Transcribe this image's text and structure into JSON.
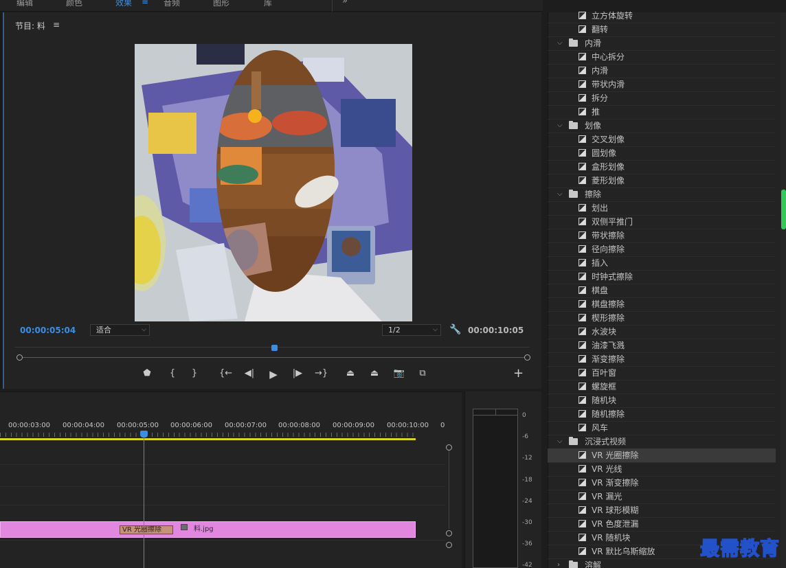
{
  "workspace_tabs": [
    {
      "label": "编辑",
      "active": false
    },
    {
      "label": "颜色",
      "active": false
    },
    {
      "label": "效果",
      "active": true
    },
    {
      "label": "音频",
      "active": false
    },
    {
      "label": "图形",
      "active": false
    },
    {
      "label": "库",
      "active": false
    }
  ],
  "workspace_more": "»",
  "program_monitor": {
    "title": "节目: 料",
    "menu_icon": "≡",
    "current_time": "00:00:05:04",
    "fit_select": "适合",
    "resolution_select": "1/2",
    "duration": "00:00:10:05",
    "scrub_position_fraction": 0.5,
    "controls": [
      {
        "name": "add-marker-icon",
        "glyph": "⬟"
      },
      {
        "name": "mark-in-icon",
        "glyph": "{"
      },
      {
        "name": "mark-out-icon",
        "glyph": "}"
      },
      {
        "name": "go-to-in-icon",
        "glyph": "{←"
      },
      {
        "name": "step-back-icon",
        "glyph": "◀|"
      },
      {
        "name": "play-icon",
        "glyph": "▶"
      },
      {
        "name": "step-forward-icon",
        "glyph": "|▶"
      },
      {
        "name": "go-to-out-icon",
        "glyph": "→}"
      },
      {
        "name": "lift-icon",
        "glyph": "⏏"
      },
      {
        "name": "extract-icon",
        "glyph": "⏏"
      },
      {
        "name": "export-frame-icon",
        "glyph": "📷"
      },
      {
        "name": "comparison-view-icon",
        "glyph": "⧉"
      }
    ],
    "add_button": "+"
  },
  "timeline": {
    "ruler_labels": [
      "00:00:03:00",
      "00:00:04:00",
      "00:00:05:00",
      "00:00:06:00",
      "00:00:07:00",
      "00:00:08:00",
      "00:00:09:00",
      "00:00:10:00",
      "0"
    ],
    "clip": {
      "transition_label": "VR 光圈擦除",
      "fx_badge": "fx",
      "name": "料.jpg",
      "color": "#e287e0"
    }
  },
  "audio_meter": {
    "labels": [
      "0",
      "-6",
      "-12",
      "-18",
      "-24",
      "-30",
      "-36",
      "-42"
    ]
  },
  "effects_panel": {
    "rows": [
      {
        "type": "effect",
        "label": "立方体旋转"
      },
      {
        "type": "effect",
        "label": "翻转"
      },
      {
        "type": "folder",
        "label": "内滑",
        "expanded": true
      },
      {
        "type": "effect",
        "label": "中心拆分"
      },
      {
        "type": "effect",
        "label": "内滑"
      },
      {
        "type": "effect",
        "label": "带状内滑"
      },
      {
        "type": "effect",
        "label": "拆分"
      },
      {
        "type": "effect",
        "label": "推"
      },
      {
        "type": "folder",
        "label": "划像",
        "expanded": true
      },
      {
        "type": "effect",
        "label": "交叉划像"
      },
      {
        "type": "effect",
        "label": "圆划像"
      },
      {
        "type": "effect",
        "label": "盒形划像"
      },
      {
        "type": "effect",
        "label": "菱形划像"
      },
      {
        "type": "folder",
        "label": "擦除",
        "expanded": true
      },
      {
        "type": "effect",
        "label": "划出"
      },
      {
        "type": "effect",
        "label": "双侧平推门"
      },
      {
        "type": "effect",
        "label": "带状擦除"
      },
      {
        "type": "effect",
        "label": "径向擦除"
      },
      {
        "type": "effect",
        "label": "插入"
      },
      {
        "type": "effect",
        "label": "时钟式擦除"
      },
      {
        "type": "effect",
        "label": "棋盘"
      },
      {
        "type": "effect",
        "label": "棋盘擦除"
      },
      {
        "type": "effect",
        "label": "楔形擦除"
      },
      {
        "type": "effect",
        "label": "水波块"
      },
      {
        "type": "effect",
        "label": "油漆飞溅"
      },
      {
        "type": "effect",
        "label": "渐变擦除"
      },
      {
        "type": "effect",
        "label": "百叶窗"
      },
      {
        "type": "effect",
        "label": "螺旋框"
      },
      {
        "type": "effect",
        "label": "随机块"
      },
      {
        "type": "effect",
        "label": "随机擦除"
      },
      {
        "type": "effect",
        "label": "风车"
      },
      {
        "type": "folder",
        "label": "沉浸式视频",
        "expanded": true
      },
      {
        "type": "effect",
        "label": "VR 光圈擦除",
        "selected": true
      },
      {
        "type": "effect",
        "label": "VR 光线"
      },
      {
        "type": "effect",
        "label": "VR 渐变擦除"
      },
      {
        "type": "effect",
        "label": "VR 漏光"
      },
      {
        "type": "effect",
        "label": "VR 球形模糊"
      },
      {
        "type": "effect",
        "label": "VR 色度泄漏"
      },
      {
        "type": "effect",
        "label": "VR 随机块"
      },
      {
        "type": "effect",
        "label": "VR 默比乌斯缩放"
      },
      {
        "type": "folder",
        "label": "溶解",
        "expanded": false
      }
    ]
  },
  "watermark": "最需教育",
  "colors": {
    "accent": "#3d8ee3",
    "work_area": "#d8d32b",
    "clip": "#e287e0",
    "scrollbar_thumb": "#34c759"
  }
}
